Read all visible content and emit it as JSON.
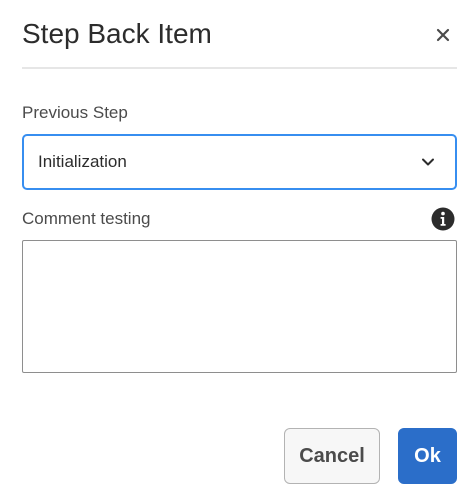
{
  "dialog": {
    "title": "Step Back Item",
    "close_icon": "close-icon"
  },
  "previous_step": {
    "label": "Previous Step",
    "selected_value": "Initialization",
    "dropdown_icon": "chevron-down-icon"
  },
  "comment": {
    "label": "Comment testing",
    "info_icon": "info-icon",
    "value": ""
  },
  "buttons": {
    "cancel_label": "Cancel",
    "ok_label": "Ok"
  },
  "colors": {
    "focus_border": "#378ef0",
    "primary_button": "#2b6ec9",
    "divider": "#e6e6e6"
  }
}
